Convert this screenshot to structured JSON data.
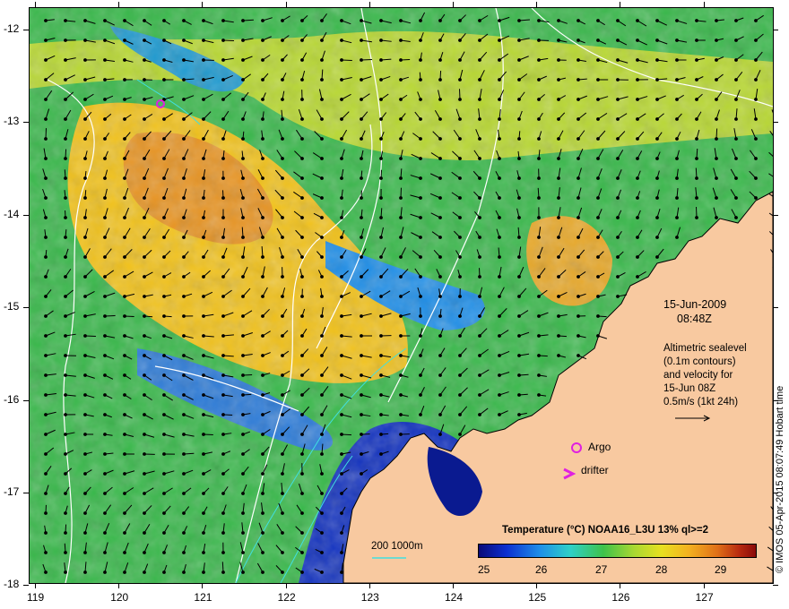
{
  "map": {
    "x_ticks": [
      "119",
      "120",
      "121",
      "122",
      "123",
      "124",
      "125",
      "126",
      "127"
    ],
    "y_ticks": [
      "-12",
      "-13",
      "-14",
      "-15",
      "-16",
      "-17",
      "-18"
    ],
    "date": "15-Jun-2009",
    "time": "08:48Z",
    "info_lines": [
      "Altimetric sealevel",
      "(0.1m contours)",
      "and velocity for",
      "15-Jun 08Z",
      "0.5m/s (1kt 24h)"
    ],
    "argo_label": "Argo",
    "drifter_label": "drifter",
    "depth_legend": "200  1000m",
    "watermark": "© IMOS 05-Apr-2015 08:07:49 Hobart time",
    "colorbar": {
      "title": "Temperature (°C) NOAA16_L3U 13% ql>=2",
      "labels": [
        "25",
        "26",
        "27",
        "28",
        "29"
      ]
    },
    "colors": {
      "land": "#f8c9a0",
      "argo": "#e020e0",
      "drifter": "#e020e0",
      "contour": "#ffffff",
      "bathy": "#40e0e0"
    }
  }
}
